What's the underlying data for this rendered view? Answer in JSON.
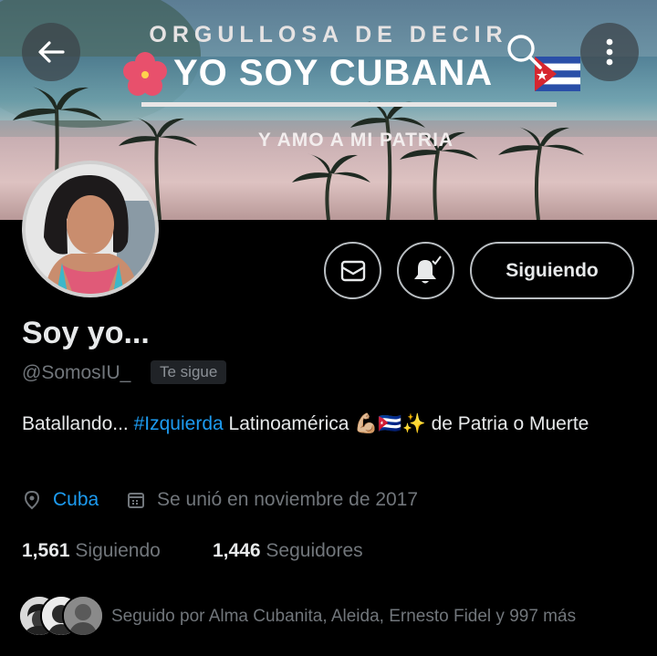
{
  "banner": {
    "kicker": "ORGULLOSA DE DECIR",
    "title": "YO SOY CUBANA",
    "subtitle": "Y AMO A MI PATRIA"
  },
  "nav": {
    "back_icon": "arrow-left-icon",
    "search_icon": "search-icon",
    "more_icon": "more-vertical-icon"
  },
  "actions": {
    "message_icon": "envelope-icon",
    "notifications_icon": "bell-check-icon",
    "follow_label": "Siguiendo"
  },
  "profile": {
    "name": "Soy yo...",
    "handle": "@SomosIU_",
    "follows_you": "Te sigue",
    "bio_prefix": "Batallando...",
    "bio_hashtag": "#Izquierda",
    "bio_middle": "Latinoamérica",
    "bio_emoji": "💪🏼🇨🇺✨",
    "bio_suffix": "de Patria o Muerte",
    "location": "Cuba",
    "joined": "Se unió en noviembre de 2017"
  },
  "stats": {
    "following_count": "1,561",
    "following_label": "Siguiendo",
    "followers_count": "1,446",
    "followers_label": "Seguidores"
  },
  "followed_by": "Seguido por Alma Cubanita, Aleida, Ernesto Fidel y 997 más",
  "colors": {
    "background": "#000000",
    "accent": "#1d9bf0",
    "muted": "#71767b"
  }
}
